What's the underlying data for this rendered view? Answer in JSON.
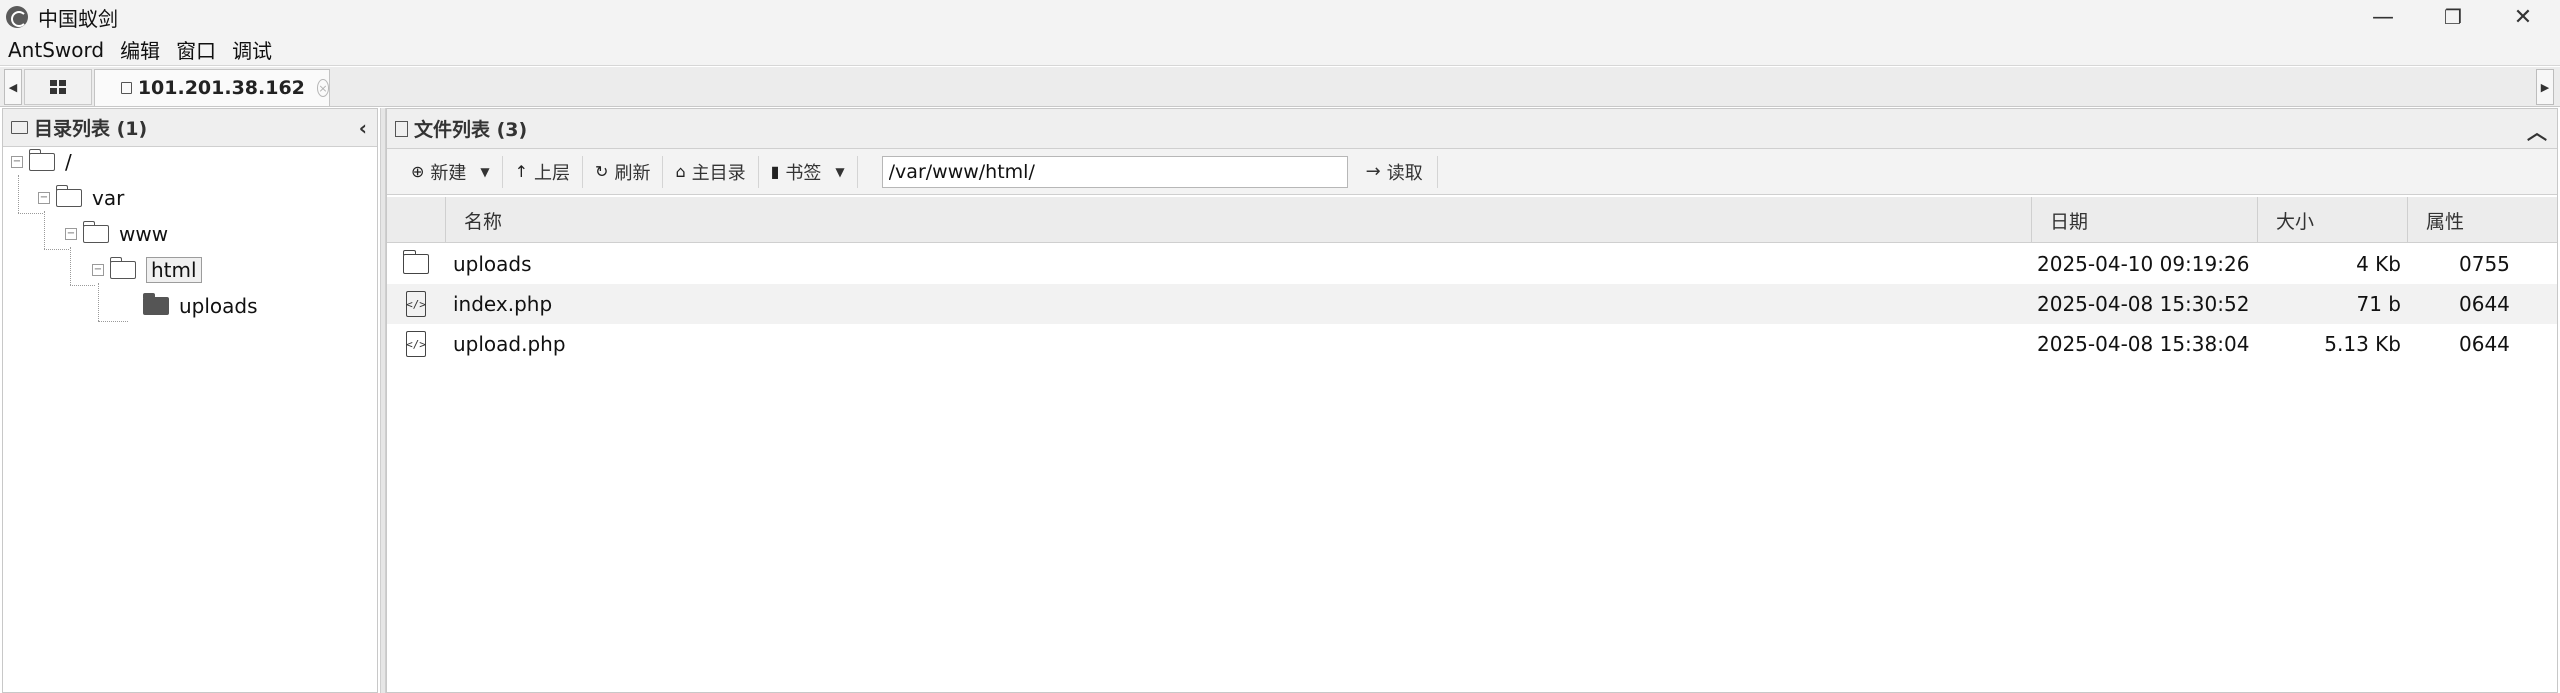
{
  "window": {
    "title": "中国蚁剑",
    "minimize": "—",
    "restore": "❐",
    "close": "✕"
  },
  "menu": [
    "AntSword",
    "编辑",
    "窗口",
    "调试"
  ],
  "tabs": {
    "host": "101.201.38.162",
    "close_glyph": "×",
    "left_arrow": "◀",
    "right_arrow": "▶"
  },
  "left_panel": {
    "title": "目录列表 (1)",
    "collapse": "‹",
    "tree": {
      "root": "/",
      "var": "var",
      "www": "www",
      "html": "html",
      "uploads": "uploads",
      "expand_glyph": "−"
    }
  },
  "right_panel": {
    "title": "文件列表 (3)",
    "collapse": "︿",
    "toolbar": {
      "new_label": "新建",
      "up_label": "上层",
      "refresh_label": "刷新",
      "home_label": "主目录",
      "bookmark_label": "书签",
      "path_value": "/var/www/html/",
      "read_label": "读取",
      "icons": {
        "new": "⊕",
        "up": "↑",
        "refresh": "↻",
        "home": "⌂",
        "bookmark": "▮",
        "read": "→",
        "caret": "▼"
      }
    },
    "columns": {
      "name": "名称",
      "date": "日期",
      "size": "大小",
      "attr": "属性"
    },
    "files": [
      {
        "name": "uploads",
        "date": "2025-04-10 09:19:26",
        "size": "4 Kb",
        "attr": "0755",
        "icon": "folder-icon"
      },
      {
        "name": "index.php",
        "date": "2025-04-08 15:30:52",
        "size": "71 b",
        "attr": "0644",
        "icon": "code-file-icon"
      },
      {
        "name": "upload.php",
        "date": "2025-04-08 15:38:04",
        "size": "5.13 Kb",
        "attr": "0644",
        "icon": "code-file-icon"
      }
    ],
    "code_glyph": "</>"
  }
}
